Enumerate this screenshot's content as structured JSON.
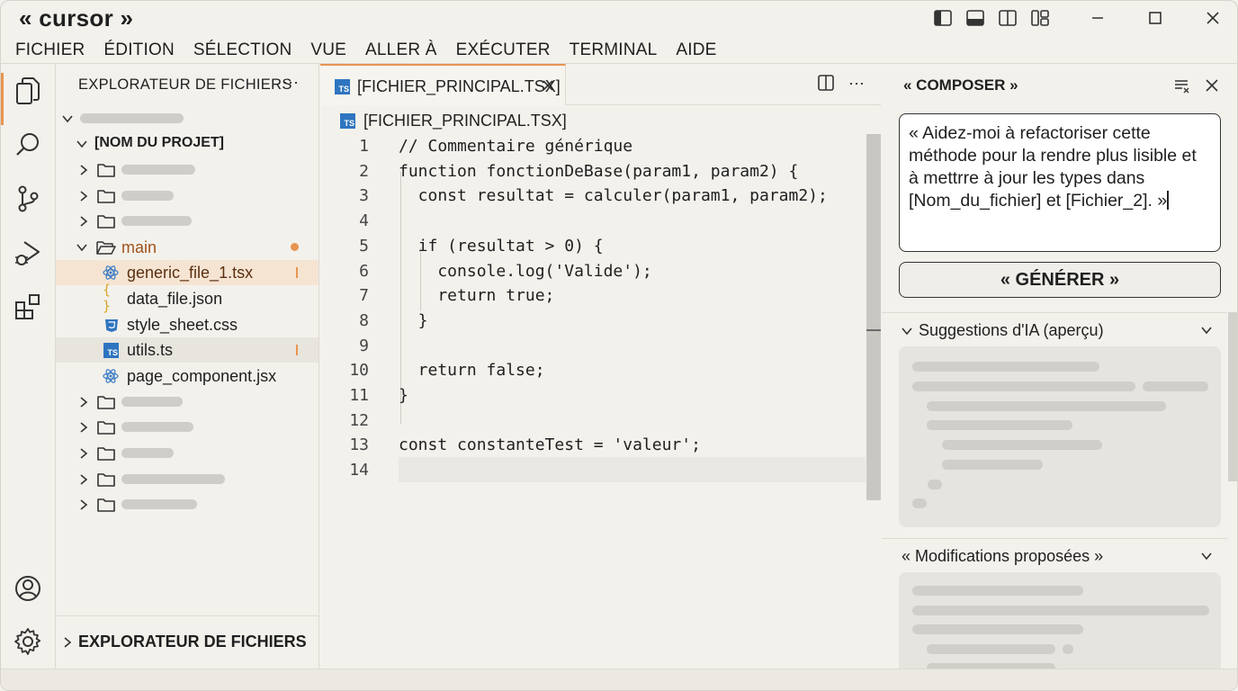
{
  "app": {
    "title": "« cursor »"
  },
  "menu": [
    "FICHIER",
    "ÉDITION",
    "SÉLECTION",
    "VUE",
    "ALLER À",
    "EXÉCUTER",
    "TERMINAL",
    "AIDE"
  ],
  "explorer": {
    "title": "EXPLORATEUR DE FICHIERS",
    "more": "···",
    "project_name": "[NOM DU PROJET]",
    "open_folder": "main",
    "files": [
      {
        "name": "generic_file_1.tsx",
        "icon": "react-icon"
      },
      {
        "name": "data_file.json",
        "icon": "json-braces-icon"
      },
      {
        "name": "style_sheet.css",
        "icon": "css-icon"
      },
      {
        "name": "utils.ts",
        "icon": "typescript-icon"
      },
      {
        "name": "page_component.jsx",
        "icon": "react-icon"
      }
    ],
    "footer_label": "EXPLORATEUR DE FICHIERS"
  },
  "editor": {
    "tab_label": "[FICHIER_PRINCIPAL.TSX]",
    "breadcrumb": "[FICHIER_PRINCIPAL.TSX]",
    "ts_badge": "TS",
    "more": "···",
    "line_numbers": [
      "1",
      "2",
      "3",
      "4",
      "5",
      "6",
      "7",
      "8",
      "9",
      "10",
      "11",
      "12",
      "13",
      "14"
    ],
    "code": [
      "// Commentaire générique",
      "function fonctionDeBase(param1, param2) {",
      "  const resultat = calculer(param1, param2);",
      "",
      "  if (resultat > 0) {",
      "    console.log('Valide');",
      "    return true;",
      "  }",
      "",
      "  return false;",
      "}",
      "",
      "const constanteTest = 'valeur';",
      ""
    ]
  },
  "composer": {
    "title": "« COMPOSER »",
    "prompt": "« Aidez-moi à refactoriser cette méthode pour la rendre plus lisible et à mettrre à jour les types dans [Nom_du_fichier] et [Fichier_2]. »",
    "generate_label": "« GÉNÉRER »",
    "suggestions_label": "Suggestions d'IA (aperçu)",
    "modifications_label": "« Modifications proposées »"
  },
  "colors": {
    "accent": "#e8944f",
    "ts_blue": "#2f74c0",
    "skeleton": "#cfcdc8"
  }
}
